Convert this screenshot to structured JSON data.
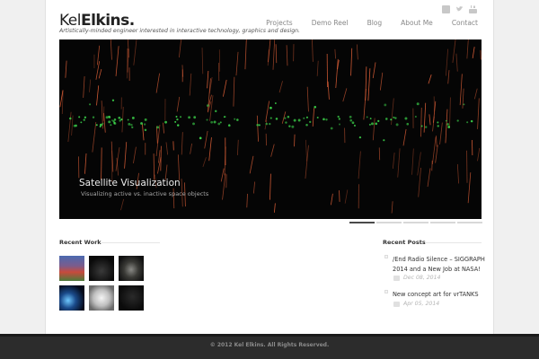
{
  "logo": {
    "first": "Kel",
    "last": "Elkins."
  },
  "tagline": "Artistically-minded engineer interested in interactive technology, graphics and design.",
  "social": [
    "linkedin-icon",
    "twitter-icon",
    "youtube-icon"
  ],
  "nav": [
    "Projects",
    "Demo Reel",
    "Blog",
    "About Me",
    "Contact"
  ],
  "hero": {
    "title": "Satellite Visualization",
    "subtitle": "Visualizing active vs. inactive space objects",
    "slides": 5,
    "active_slide": 1
  },
  "recent_work": {
    "heading": "Recent Work",
    "thumbnails": [
      "thumbnail-1",
      "thumbnail-2",
      "thumbnail-3",
      "thumbnail-4",
      "thumbnail-5",
      "thumbnail-6"
    ]
  },
  "recent_posts": {
    "heading": "Recent Posts",
    "items": [
      {
        "title": "/End Radio Silence – SIGGRAPH 2014 and a New Job at NASA!",
        "date": "Dec 08, 2014"
      },
      {
        "title": "New concept art for vrTANKS",
        "date": "Apr 05, 2014"
      }
    ]
  },
  "footer": "© 2012 Kel Elkins. All Rights Reserved.",
  "colors": {
    "streak": "#e8643a",
    "satellite": "#3cd24a",
    "footer_bg": "#2c2c2c"
  }
}
